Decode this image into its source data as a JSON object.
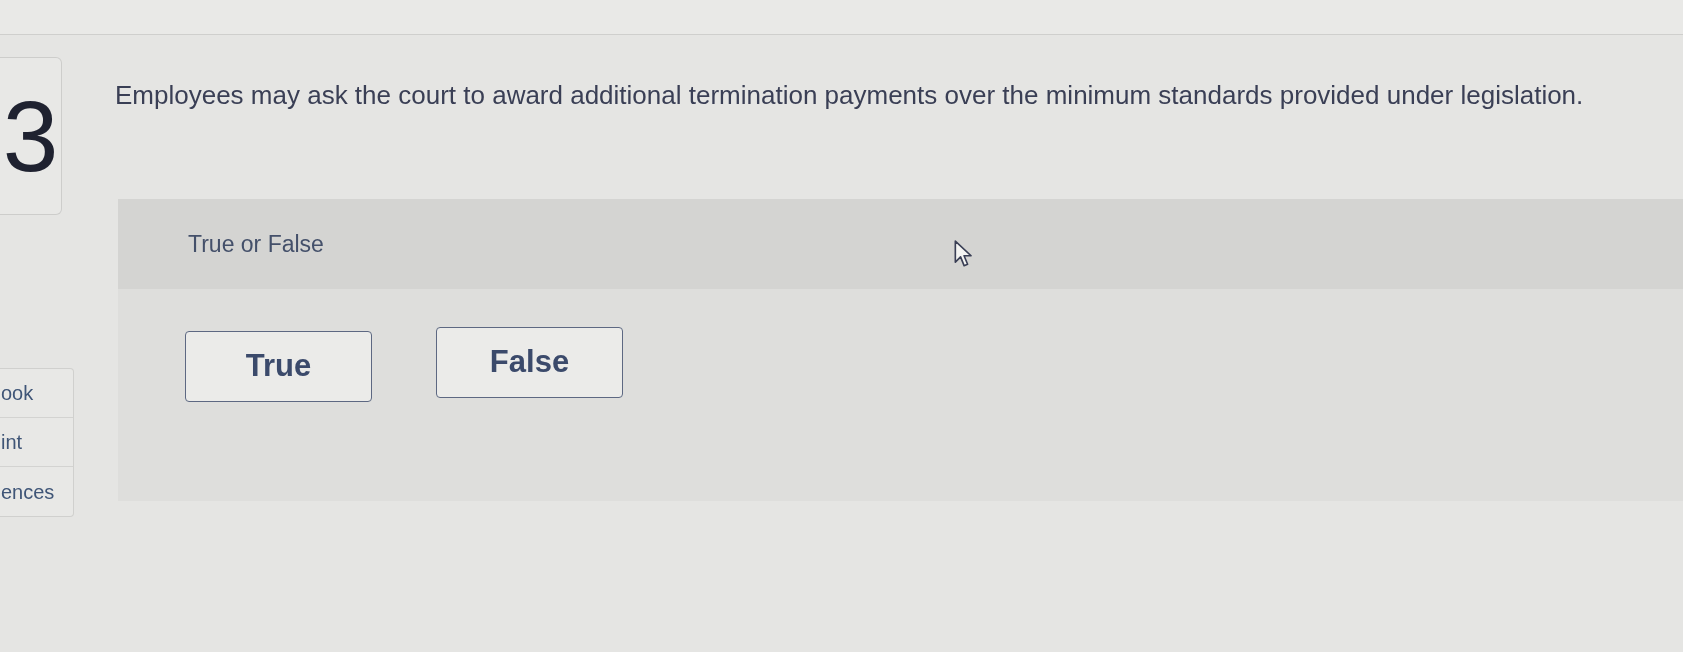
{
  "question": {
    "number": "3",
    "text": "Employees may ask the court to award additional termination payments over the minimum standards provided under legislation."
  },
  "sidebar": {
    "items": [
      {
        "label": "ook"
      },
      {
        "label": "int"
      },
      {
        "label": "ences"
      }
    ]
  },
  "answer_panel": {
    "prompt": "True or False",
    "options": [
      {
        "label": "True",
        "selected": false
      },
      {
        "label": "False",
        "selected": false
      }
    ]
  }
}
